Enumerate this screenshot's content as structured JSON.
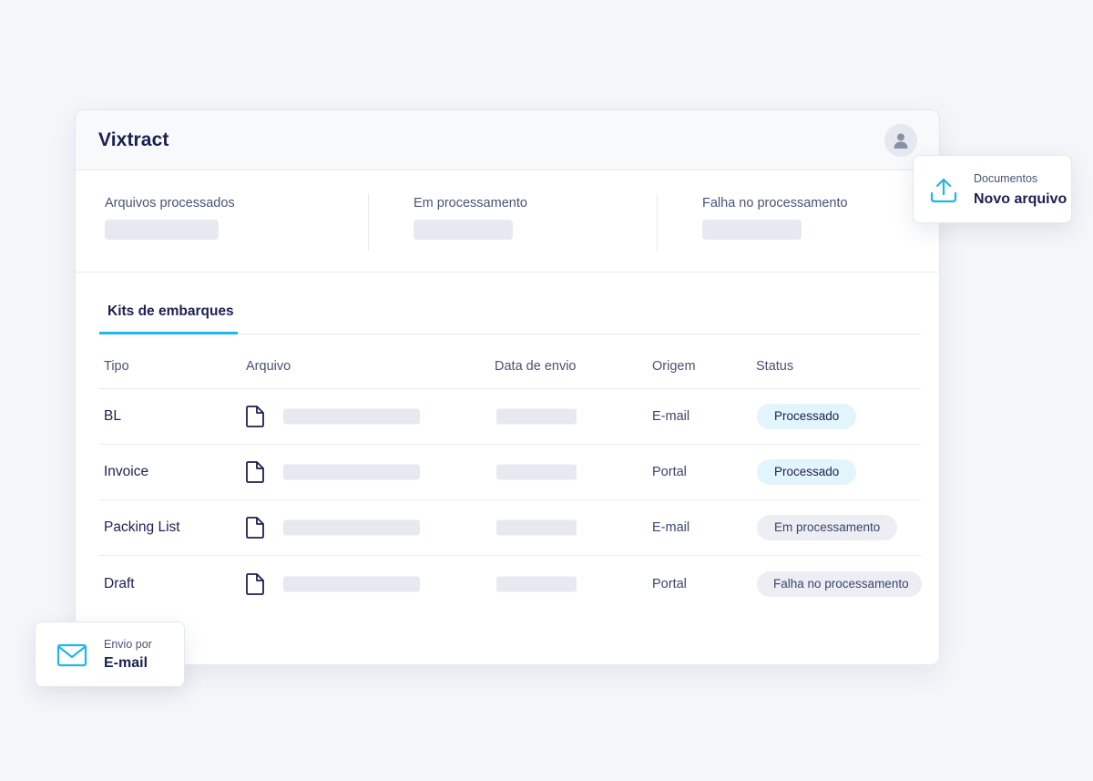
{
  "app": {
    "title": "Vixtract",
    "profile_icon": "user-icon"
  },
  "stats": [
    {
      "label": "Arquivos processados"
    },
    {
      "label": "Em processamento"
    },
    {
      "label": "Falha no processamento"
    }
  ],
  "tabs": [
    {
      "label": "Kits de embarques",
      "active": true
    }
  ],
  "table": {
    "headers": [
      "Tipo",
      "Arquivo",
      "Data de envio",
      "Origem",
      "Status"
    ],
    "rows": [
      {
        "type": "BL",
        "origin": "E-mail",
        "status": "Processado",
        "status_kind": "success"
      },
      {
        "type": "Invoice",
        "origin": "Portal",
        "status": "Processado",
        "status_kind": "success"
      },
      {
        "type": "Packing List",
        "origin": "E-mail",
        "status": "Em processamento",
        "status_kind": "pending"
      },
      {
        "type": "Draft",
        "origin": "Portal",
        "status": "Falha no processamento",
        "status_kind": "failed"
      }
    ]
  },
  "upload_card": {
    "label": "Documentos",
    "title": "Novo arquivo",
    "icon": "upload-icon"
  },
  "email_card": {
    "label": "Envio por",
    "title": "E-mail",
    "icon": "mail-icon"
  },
  "colors": {
    "accent": "#1fb6ea",
    "text_dark": "#1b2150",
    "badge_success_bg": "#e2f4fc",
    "badge_neutral_bg": "#eceef3"
  }
}
